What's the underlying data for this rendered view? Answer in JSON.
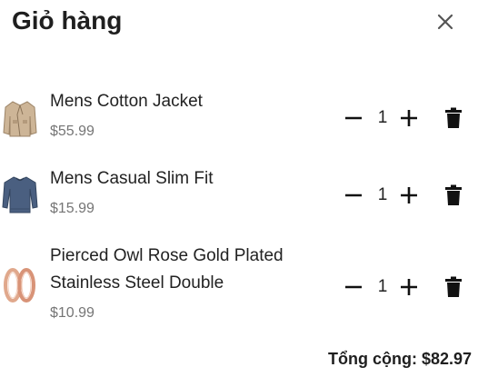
{
  "cart": {
    "title": "Giỏ hàng",
    "items": [
      {
        "name": "Mens Cotton Jacket",
        "price": "$55.99",
        "quantity": "1",
        "image": "jacket-icon"
      },
      {
        "name": "Mens Casual Slim Fit",
        "price": "$15.99",
        "quantity": "1",
        "image": "shirt-icon"
      },
      {
        "name": "Pierced Owl Rose Gold Plated Stainless Steel Double",
        "price": "$10.99",
        "quantity": "1",
        "image": "rings-icon"
      }
    ],
    "total": "Tổng cộng: $82.97"
  },
  "icons": {
    "close": "close-icon",
    "minus": "minus-icon",
    "plus": "plus-icon",
    "trash": "trash-icon"
  },
  "colors": {
    "text": "#1f1f1f",
    "price": "#757575",
    "background": "#ffffff"
  }
}
